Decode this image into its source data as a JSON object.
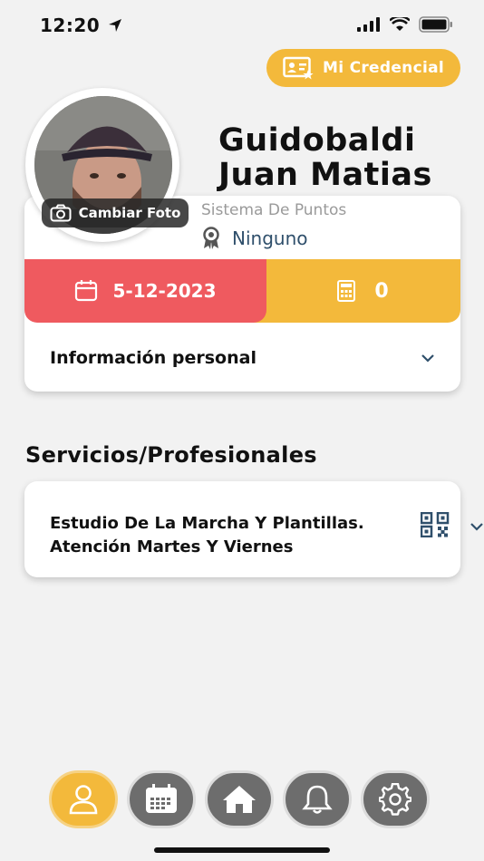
{
  "status_bar": {
    "time": "12:20"
  },
  "credential_button": {
    "label": "Mi Credencial"
  },
  "profile": {
    "first_line": "Guidobaldi",
    "second_line": "Juan Matias",
    "change_photo_label": "Cambiar Foto",
    "points_label": "Sistema De Puntos",
    "points_value": "Ninguno",
    "date": "5-12-2023",
    "counter": "0"
  },
  "personal_info": {
    "label": "Información personal"
  },
  "services": {
    "title": "Servicios/Profesionales",
    "items": [
      {
        "line1": "Estudio De La Marcha Y Plantillas.",
        "line2": "Atención Martes Y Viernes"
      }
    ]
  },
  "bottom_nav": {
    "items": [
      {
        "icon": "user-icon",
        "active": true
      },
      {
        "icon": "calendar-icon",
        "active": false
      },
      {
        "icon": "home-icon",
        "active": false
      },
      {
        "icon": "bell-icon",
        "active": false
      },
      {
        "icon": "settings-icon",
        "active": false
      }
    ]
  },
  "colors": {
    "accent": "#f3b93b",
    "red": "#ef5a5f",
    "navy": "#2f4f6b",
    "nav_gray": "#6d6d6d"
  }
}
